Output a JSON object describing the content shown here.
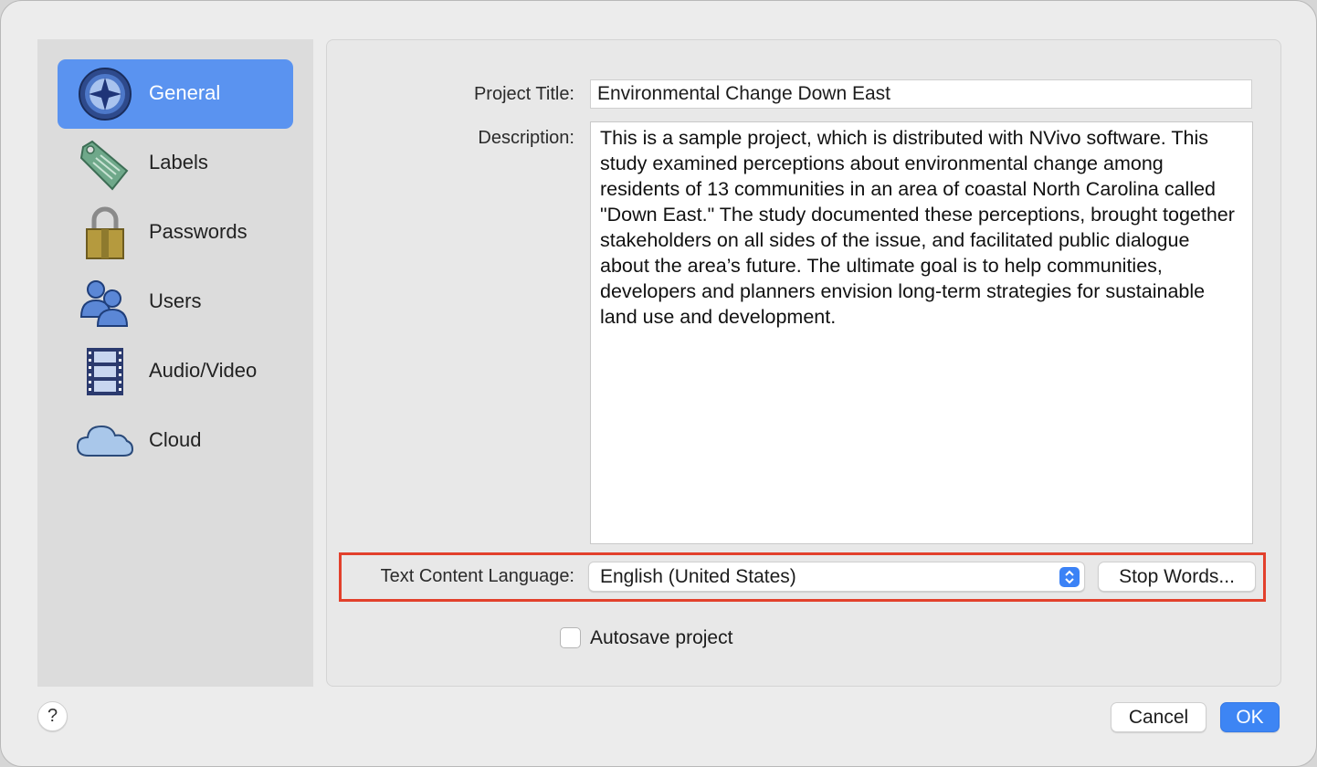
{
  "sidebar": {
    "items": [
      {
        "label": "General",
        "icon": "nvivo-star-icon"
      },
      {
        "label": "Labels",
        "icon": "tag-icon"
      },
      {
        "label": "Passwords",
        "icon": "padlock-icon"
      },
      {
        "label": "Users",
        "icon": "users-icon"
      },
      {
        "label": "Audio/Video",
        "icon": "film-strip-icon"
      },
      {
        "label": "Cloud",
        "icon": "cloud-icon"
      }
    ],
    "selected": "General"
  },
  "form": {
    "title_label": "Project Title:",
    "title_value": "Environmental Change Down East",
    "description_label": "Description:",
    "description_value": "This is a sample project, which is distributed with NVivo software. This study examined perceptions about environmental change among residents of 13 communities in an area of coastal North Carolina called \"Down East.\" The study documented these perceptions, brought together stakeholders on all sides of the issue, and facilitated public dialogue about the area’s future. The ultimate goal is to help communities, developers and planners envision long-term strategies for sustainable land use and development.",
    "language_label": "Text Content Language:",
    "language_value": "English (United States)",
    "stop_words_label": "Stop Words...",
    "autosave_label": "Autosave project",
    "autosave_checked": false
  },
  "footer": {
    "help_label": "?",
    "cancel_label": "Cancel",
    "ok_label": "OK"
  },
  "colors": {
    "accent": "#3d85f4",
    "selected_item": "#5a93f0",
    "highlight_border": "#e2402c"
  }
}
